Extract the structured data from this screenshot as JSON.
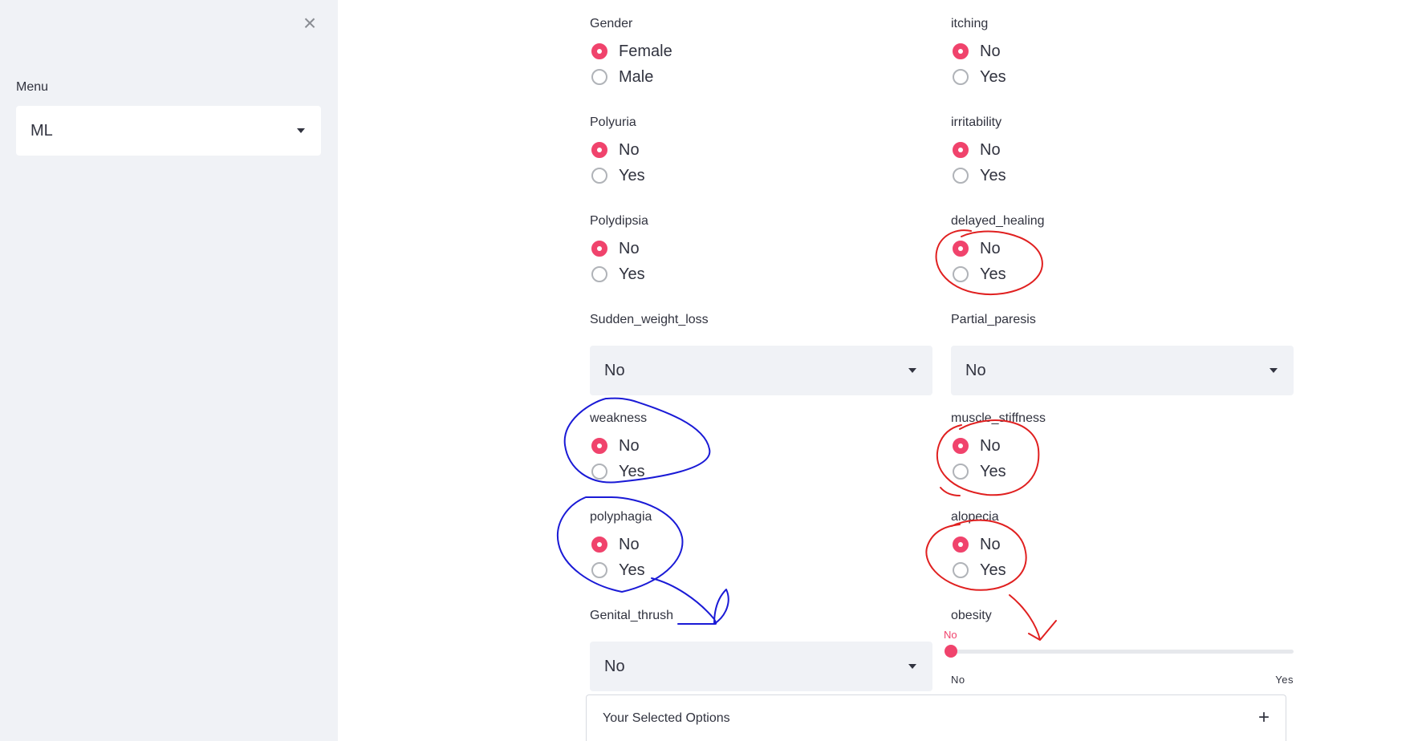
{
  "sidebar": {
    "close_icon": "×",
    "menu_label": "Menu",
    "menu_value": "ML"
  },
  "left_fields": [
    {
      "label": "Gender",
      "kind": "radio",
      "options": [
        "Female",
        "Male"
      ],
      "selected": 0
    },
    {
      "label": "Polyuria",
      "kind": "radio",
      "options": [
        "No",
        "Yes"
      ],
      "selected": 0
    },
    {
      "label": "Polydipsia",
      "kind": "radio",
      "options": [
        "No",
        "Yes"
      ],
      "selected": 0
    },
    {
      "label": "Sudden_weight_loss",
      "kind": "select",
      "value": "No"
    },
    {
      "label": "weakness",
      "kind": "radio",
      "options": [
        "No",
        "Yes"
      ],
      "selected": 0
    },
    {
      "label": "polyphagia",
      "kind": "radio",
      "options": [
        "No",
        "Yes"
      ],
      "selected": 0
    },
    {
      "label": "Genital_thrush",
      "kind": "select",
      "value": "No"
    }
  ],
  "right_fields": [
    {
      "label": "itching",
      "kind": "radio",
      "options": [
        "No",
        "Yes"
      ],
      "selected": 0
    },
    {
      "label": "irritability",
      "kind": "radio",
      "options": [
        "No",
        "Yes"
      ],
      "selected": 0
    },
    {
      "label": "delayed_healing",
      "kind": "radio",
      "options": [
        "No",
        "Yes"
      ],
      "selected": 0
    },
    {
      "label": "Partial_paresis",
      "kind": "select",
      "value": "No"
    },
    {
      "label": "muscle_stiffness",
      "kind": "radio",
      "options": [
        "No",
        "Yes"
      ],
      "selected": 0
    },
    {
      "label": "alopecia",
      "kind": "radio",
      "options": [
        "No",
        "Yes"
      ],
      "selected": 0
    },
    {
      "label": "obesity",
      "kind": "slider",
      "value": "No",
      "min": "No",
      "max": "Yes",
      "position": 0
    }
  ],
  "expander": {
    "label": "Your Selected Options",
    "icon": "+"
  },
  "colors": {
    "accent": "#f0436c",
    "sidebar_bg": "#f0f2f6",
    "annotation_red": "#e02020",
    "annotation_blue": "#1a1ad6"
  }
}
